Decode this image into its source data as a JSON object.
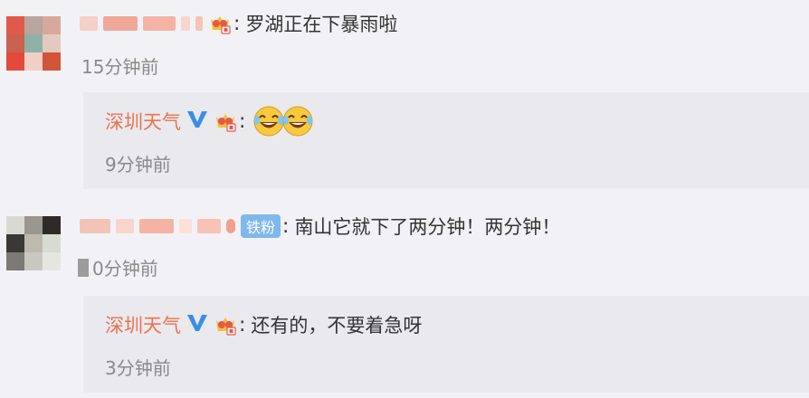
{
  "comments": [
    {
      "text": "罗湖正在下暴雨啦",
      "time": "15分钟前",
      "reply": {
        "name": "深圳天气",
        "time": "9分钟前",
        "emoji_count": 2,
        "emoji_icon": "laugh-cry-emoji"
      }
    },
    {
      "badge": "铁粉",
      "text": "南山它就下了两分钟！两分钟！",
      "time": "0分钟前",
      "reply": {
        "name": "深圳天气",
        "text": "还有的，不要着急呀",
        "time": "3分钟前"
      }
    }
  ],
  "colors": {
    "background": "#f2f2f6",
    "reply_background": "#e9e9ee",
    "reply_name": "#eb7350",
    "time": "#8a8a8a",
    "verified_blue": "#3a8ee6",
    "fan_badge": "#7fb8ec",
    "crown_red": "#e8574a",
    "crown_gold": "#f2c230"
  },
  "icons": {
    "verified": "verified-v-icon",
    "crown": "vip-crown-icon"
  }
}
